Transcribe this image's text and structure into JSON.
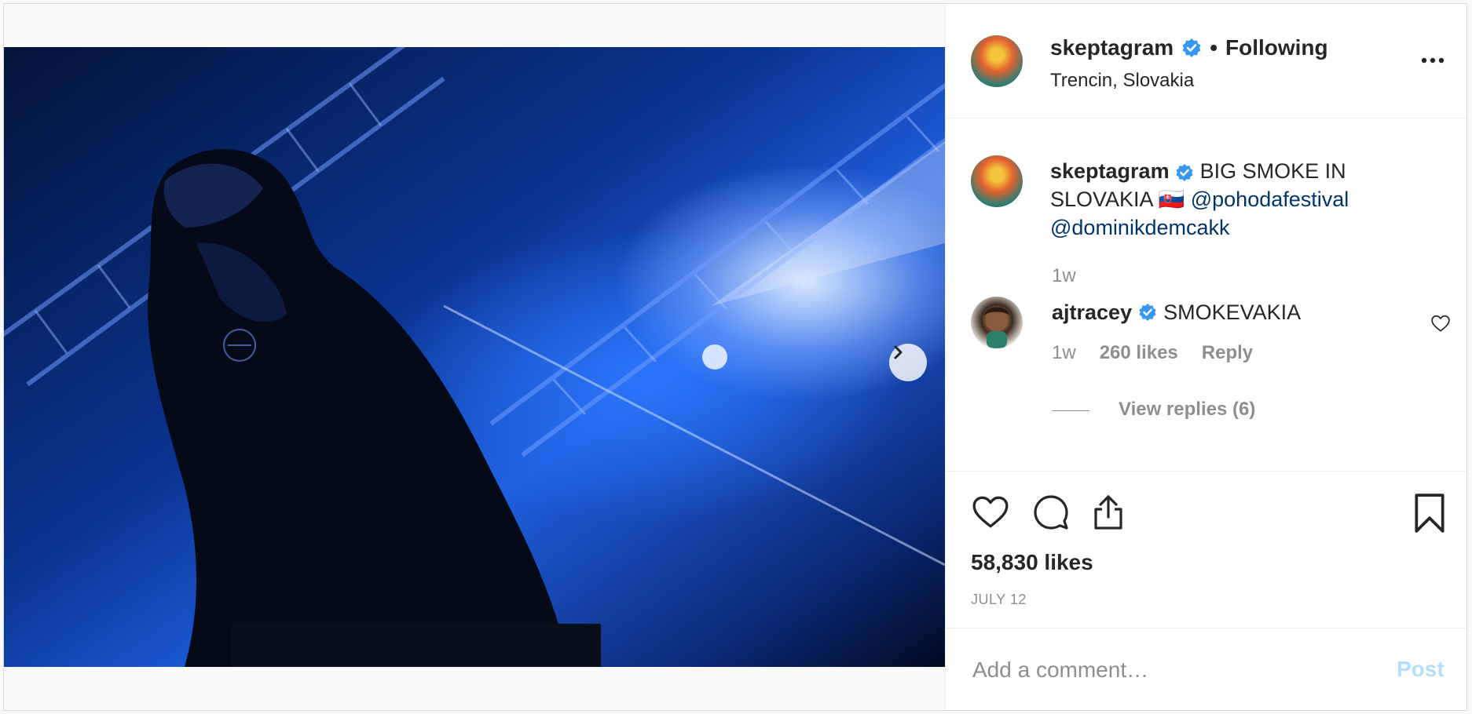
{
  "post": {
    "media": {
      "image_alt": "performer in a hood on a blue-lit stage",
      "carousel_total": 2,
      "carousel_current": 1
    },
    "author": {
      "username": "skeptagram",
      "verified": true,
      "follow_separator": "•",
      "follow_status": "Following",
      "location": "Trencin, Slovakia"
    },
    "caption": {
      "username": "skeptagram",
      "text_before": "BIG SMOKE IN SLOVAKIA",
      "flag": "🇸🇰",
      "mention_1": "@pohodafestival",
      "mention_2": "@dominikdemcakk",
      "time": "1w"
    },
    "comments": [
      {
        "username": "ajtracey",
        "verified": true,
        "text": "SMOKEVAKIA",
        "time": "1w",
        "likes": "260 likes",
        "reply_label": "Reply",
        "view_replies": "View replies (6)"
      }
    ],
    "likes": "58,830 likes",
    "date": "JULY 12",
    "add_comment": {
      "placeholder": "Add a comment…",
      "post_label": "Post"
    },
    "icons": [
      "verified-badge-icon",
      "more-options-icon",
      "chevron-right-icon",
      "like-icon",
      "comment-icon",
      "share-icon",
      "save-bookmark-icon",
      "comment-like-icon"
    ],
    "colors": {
      "verified_blue": "#3897f0",
      "mention": "#003569",
      "muted": "#8e8e8e",
      "post_button_disabled": "#b2dffc",
      "photo_accent": "#1f5fe0"
    }
  }
}
